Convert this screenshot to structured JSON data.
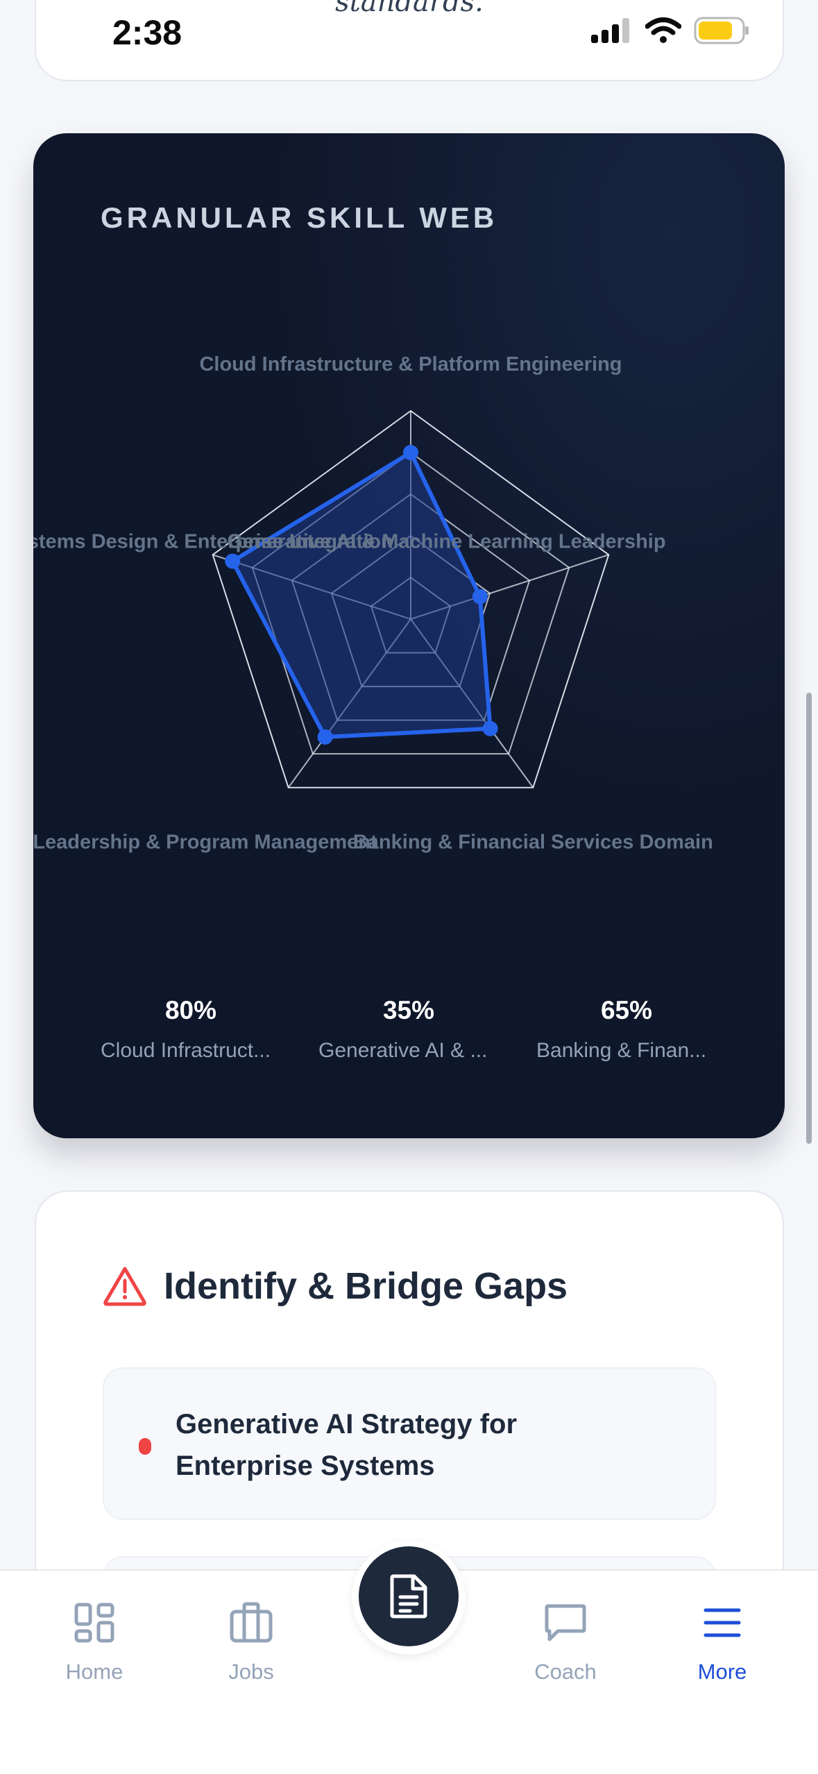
{
  "status_bar": {
    "time": "2:38",
    "icons": [
      "cellular-signal-icon",
      "wifi-icon",
      "battery-icon"
    ],
    "battery_color": "#facc15"
  },
  "top_card": {
    "cut_text": "standards."
  },
  "skill_web": {
    "title": "GRANULAR SKILL WEB",
    "colors": {
      "accent": "#2563eb",
      "fill": "#1e3a8a",
      "grid": "#e2e8f0",
      "label": "#64748b"
    },
    "summary": [
      {
        "value": "80%",
        "label": "Cloud Infrastruct..."
      },
      {
        "value": "35%",
        "label": "Generative AI & ..."
      },
      {
        "value": "65%",
        "label": "Banking & Finan..."
      }
    ]
  },
  "chart_data": {
    "type": "radar",
    "title": "",
    "axes": [
      "Cloud Infrastructure & Platform Engineering",
      "Generative AI & Machine Learning Leadership",
      "Banking & Financial Services Domain",
      "Technical Leadership & Program Management",
      "Systems Design & Enterprise Integration"
    ],
    "values": [
      80,
      35,
      65,
      70,
      90
    ],
    "range": [
      0,
      100
    ],
    "rings": 5,
    "grid": true
  },
  "gaps": {
    "title": "Identify & Bridge Gaps",
    "items": [
      {
        "text": "Generative AI Strategy for Enterprise Systems",
        "severity_color": "#ef4444"
      }
    ]
  },
  "tabbar": {
    "tabs": [
      {
        "label": "Home",
        "icon": "grid-icon"
      },
      {
        "label": "Jobs",
        "icon": "briefcase-icon"
      },
      {
        "label": "Coach",
        "icon": "chat-bubble-icon"
      },
      {
        "label": "More",
        "icon": "menu-icon",
        "active": true
      }
    ],
    "fab_icon": "document-icon"
  }
}
